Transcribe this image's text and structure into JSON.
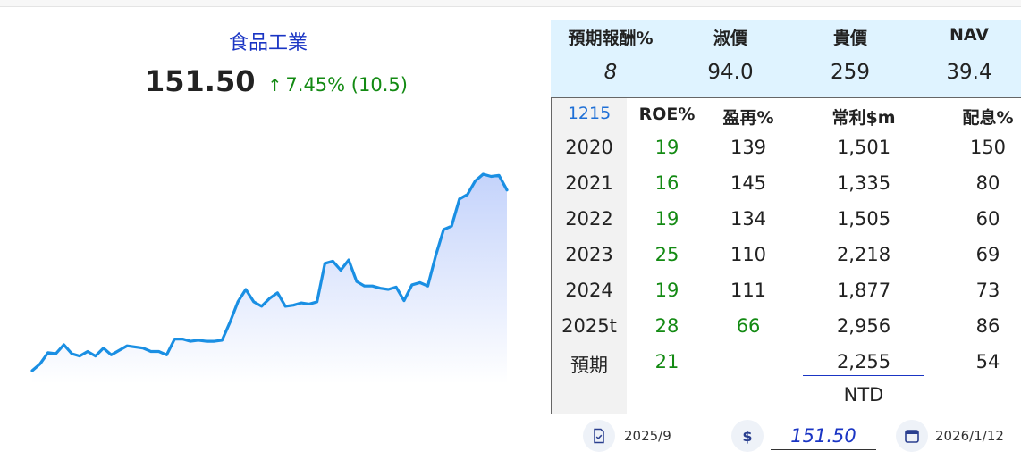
{
  "header": {
    "title": "食品工業",
    "price": "151.50",
    "change_arrow": "↑",
    "change_text": "7.45% (10.5)"
  },
  "chart_data": {
    "type": "area",
    "line_color": "#1a8fe3",
    "fill_color": "#c7d6fa",
    "values": [
      10.0,
      10.6,
      11.6,
      11.5,
      12.3,
      11.5,
      11.3,
      11.7,
      11.3,
      12.0,
      11.4,
      11.8,
      12.2,
      12.1,
      12.0,
      11.7,
      11.7,
      11.4,
      12.8,
      12.8,
      12.6,
      12.7,
      12.6,
      12.6,
      12.7,
      14.3,
      16.1,
      17.2,
      16.1,
      15.7,
      16.4,
      16.9,
      15.7,
      15.8,
      16.0,
      15.9,
      16.1,
      19.5,
      19.7,
      18.9,
      19.8,
      17.9,
      17.5,
      17.5,
      17.3,
      17.2,
      17.4,
      16.2,
      17.6,
      17.8,
      17.5,
      20.2,
      22.5,
      22.8,
      25.2,
      25.6,
      26.8,
      27.4,
      27.2,
      27.3,
      26.0
    ]
  },
  "summary": {
    "headers": [
      "預期報酬%",
      "淑價",
      "貴價",
      "NAV"
    ],
    "values": [
      "8",
      "94.0",
      "259",
      "39.4"
    ]
  },
  "table": {
    "code": "1215",
    "headers": [
      "ROE%",
      "盈再%",
      "常利$m",
      "配息%"
    ],
    "rows": [
      {
        "year": "2020",
        "roe": "19",
        "reinv": "139",
        "profit": "1,501",
        "div": "150"
      },
      {
        "year": "2021",
        "roe": "16",
        "reinv": "145",
        "profit": "1,335",
        "div": "80"
      },
      {
        "year": "2022",
        "roe": "19",
        "reinv": "134",
        "profit": "1,505",
        "div": "60"
      },
      {
        "year": "2023",
        "roe": "25",
        "reinv": "110",
        "profit": "2,218",
        "div": "69"
      },
      {
        "year": "2024",
        "roe": "19",
        "reinv": "111",
        "profit": "1,877",
        "div": "73"
      },
      {
        "year": "2025t",
        "roe": "28",
        "reinv": "66",
        "profit": "2,956",
        "div": "86"
      },
      {
        "year": "預期",
        "roe": "21",
        "reinv": "",
        "profit": "2,255",
        "div": "54"
      }
    ],
    "currency": "NTD"
  },
  "bottom": {
    "report_date": "2025/9",
    "dollar_symbol": "$",
    "price_value": "151.50",
    "current_date": "2026/1/12",
    "report_icon": "document-check-icon",
    "calendar_icon": "calendar-icon"
  }
}
